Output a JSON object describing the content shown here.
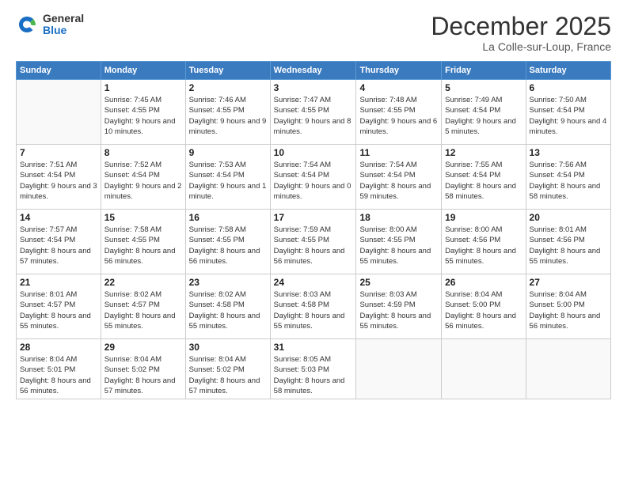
{
  "logo": {
    "general": "General",
    "blue": "Blue"
  },
  "header": {
    "month": "December 2025",
    "location": "La Colle-sur-Loup, France"
  },
  "weekdays": [
    "Sunday",
    "Monday",
    "Tuesday",
    "Wednesday",
    "Thursday",
    "Friday",
    "Saturday"
  ],
  "weeks": [
    [
      {
        "day": "",
        "sunrise": "",
        "sunset": "",
        "daylight": ""
      },
      {
        "day": "1",
        "sunrise": "Sunrise: 7:45 AM",
        "sunset": "Sunset: 4:55 PM",
        "daylight": "Daylight: 9 hours and 10 minutes."
      },
      {
        "day": "2",
        "sunrise": "Sunrise: 7:46 AM",
        "sunset": "Sunset: 4:55 PM",
        "daylight": "Daylight: 9 hours and 9 minutes."
      },
      {
        "day": "3",
        "sunrise": "Sunrise: 7:47 AM",
        "sunset": "Sunset: 4:55 PM",
        "daylight": "Daylight: 9 hours and 8 minutes."
      },
      {
        "day": "4",
        "sunrise": "Sunrise: 7:48 AM",
        "sunset": "Sunset: 4:55 PM",
        "daylight": "Daylight: 9 hours and 6 minutes."
      },
      {
        "day": "5",
        "sunrise": "Sunrise: 7:49 AM",
        "sunset": "Sunset: 4:54 PM",
        "daylight": "Daylight: 9 hours and 5 minutes."
      },
      {
        "day": "6",
        "sunrise": "Sunrise: 7:50 AM",
        "sunset": "Sunset: 4:54 PM",
        "daylight": "Daylight: 9 hours and 4 minutes."
      }
    ],
    [
      {
        "day": "7",
        "sunrise": "Sunrise: 7:51 AM",
        "sunset": "Sunset: 4:54 PM",
        "daylight": "Daylight: 9 hours and 3 minutes."
      },
      {
        "day": "8",
        "sunrise": "Sunrise: 7:52 AM",
        "sunset": "Sunset: 4:54 PM",
        "daylight": "Daylight: 9 hours and 2 minutes."
      },
      {
        "day": "9",
        "sunrise": "Sunrise: 7:53 AM",
        "sunset": "Sunset: 4:54 PM",
        "daylight": "Daylight: 9 hours and 1 minute."
      },
      {
        "day": "10",
        "sunrise": "Sunrise: 7:54 AM",
        "sunset": "Sunset: 4:54 PM",
        "daylight": "Daylight: 9 hours and 0 minutes."
      },
      {
        "day": "11",
        "sunrise": "Sunrise: 7:54 AM",
        "sunset": "Sunset: 4:54 PM",
        "daylight": "Daylight: 8 hours and 59 minutes."
      },
      {
        "day": "12",
        "sunrise": "Sunrise: 7:55 AM",
        "sunset": "Sunset: 4:54 PM",
        "daylight": "Daylight: 8 hours and 58 minutes."
      },
      {
        "day": "13",
        "sunrise": "Sunrise: 7:56 AM",
        "sunset": "Sunset: 4:54 PM",
        "daylight": "Daylight: 8 hours and 58 minutes."
      }
    ],
    [
      {
        "day": "14",
        "sunrise": "Sunrise: 7:57 AM",
        "sunset": "Sunset: 4:54 PM",
        "daylight": "Daylight: 8 hours and 57 minutes."
      },
      {
        "day": "15",
        "sunrise": "Sunrise: 7:58 AM",
        "sunset": "Sunset: 4:55 PM",
        "daylight": "Daylight: 8 hours and 56 minutes."
      },
      {
        "day": "16",
        "sunrise": "Sunrise: 7:58 AM",
        "sunset": "Sunset: 4:55 PM",
        "daylight": "Daylight: 8 hours and 56 minutes."
      },
      {
        "day": "17",
        "sunrise": "Sunrise: 7:59 AM",
        "sunset": "Sunset: 4:55 PM",
        "daylight": "Daylight: 8 hours and 56 minutes."
      },
      {
        "day": "18",
        "sunrise": "Sunrise: 8:00 AM",
        "sunset": "Sunset: 4:55 PM",
        "daylight": "Daylight: 8 hours and 55 minutes."
      },
      {
        "day": "19",
        "sunrise": "Sunrise: 8:00 AM",
        "sunset": "Sunset: 4:56 PM",
        "daylight": "Daylight: 8 hours and 55 minutes."
      },
      {
        "day": "20",
        "sunrise": "Sunrise: 8:01 AM",
        "sunset": "Sunset: 4:56 PM",
        "daylight": "Daylight: 8 hours and 55 minutes."
      }
    ],
    [
      {
        "day": "21",
        "sunrise": "Sunrise: 8:01 AM",
        "sunset": "Sunset: 4:57 PM",
        "daylight": "Daylight: 8 hours and 55 minutes."
      },
      {
        "day": "22",
        "sunrise": "Sunrise: 8:02 AM",
        "sunset": "Sunset: 4:57 PM",
        "daylight": "Daylight: 8 hours and 55 minutes."
      },
      {
        "day": "23",
        "sunrise": "Sunrise: 8:02 AM",
        "sunset": "Sunset: 4:58 PM",
        "daylight": "Daylight: 8 hours and 55 minutes."
      },
      {
        "day": "24",
        "sunrise": "Sunrise: 8:03 AM",
        "sunset": "Sunset: 4:58 PM",
        "daylight": "Daylight: 8 hours and 55 minutes."
      },
      {
        "day": "25",
        "sunrise": "Sunrise: 8:03 AM",
        "sunset": "Sunset: 4:59 PM",
        "daylight": "Daylight: 8 hours and 55 minutes."
      },
      {
        "day": "26",
        "sunrise": "Sunrise: 8:04 AM",
        "sunset": "Sunset: 5:00 PM",
        "daylight": "Daylight: 8 hours and 56 minutes."
      },
      {
        "day": "27",
        "sunrise": "Sunrise: 8:04 AM",
        "sunset": "Sunset: 5:00 PM",
        "daylight": "Daylight: 8 hours and 56 minutes."
      }
    ],
    [
      {
        "day": "28",
        "sunrise": "Sunrise: 8:04 AM",
        "sunset": "Sunset: 5:01 PM",
        "daylight": "Daylight: 8 hours and 56 minutes."
      },
      {
        "day": "29",
        "sunrise": "Sunrise: 8:04 AM",
        "sunset": "Sunset: 5:02 PM",
        "daylight": "Daylight: 8 hours and 57 minutes."
      },
      {
        "day": "30",
        "sunrise": "Sunrise: 8:04 AM",
        "sunset": "Sunset: 5:02 PM",
        "daylight": "Daylight: 8 hours and 57 minutes."
      },
      {
        "day": "31",
        "sunrise": "Sunrise: 8:05 AM",
        "sunset": "Sunset: 5:03 PM",
        "daylight": "Daylight: 8 hours and 58 minutes."
      },
      {
        "day": "",
        "sunrise": "",
        "sunset": "",
        "daylight": ""
      },
      {
        "day": "",
        "sunrise": "",
        "sunset": "",
        "daylight": ""
      },
      {
        "day": "",
        "sunrise": "",
        "sunset": "",
        "daylight": ""
      }
    ]
  ]
}
